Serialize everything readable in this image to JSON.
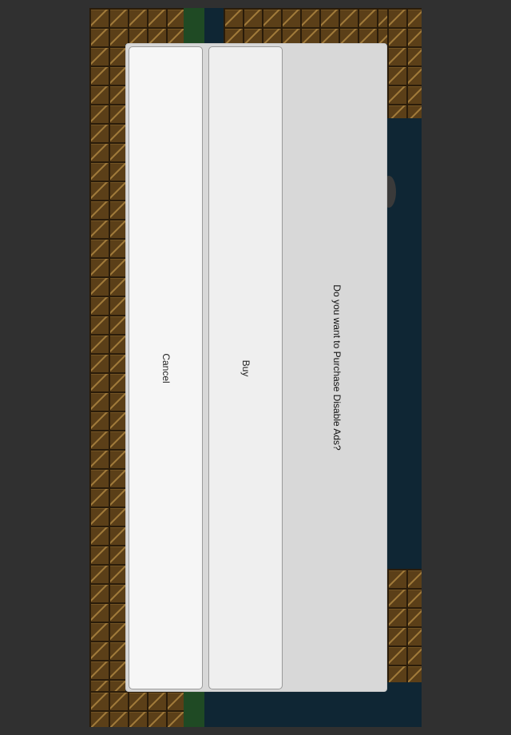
{
  "dialog": {
    "message": "Do you want to Purchase Disable Ads?",
    "buttons": {
      "buy_label": "Buy",
      "cancel_label": "Cancel"
    }
  },
  "colors": {
    "backdrop": "#303030",
    "brick": "#5b3f18",
    "water": "#0f2634",
    "dialog_bg": "#d8d8d8",
    "button_bg": "#f6f6f6"
  }
}
